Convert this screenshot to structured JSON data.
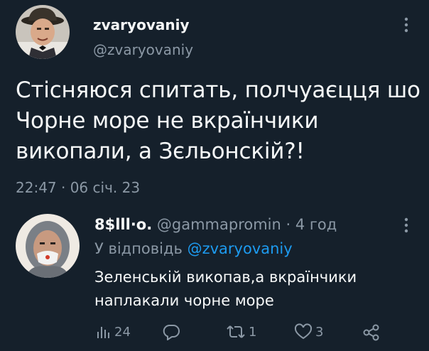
{
  "tweet": {
    "author_name": "zvaryovaniy",
    "author_handle": "@zvaryovaniy",
    "text": "Стісняюся спитать, полчуаєцця шо Чорне море не вкраїнчики викопали, а Зєльонскій?!",
    "timestamp": "22:47 · 06 січ. 23"
  },
  "reply": {
    "author_name": "8$lll·o.",
    "author_handle": "@gammapromin",
    "separator": " · ",
    "time": "4 год",
    "reply_to_prefix": "У відповідь ",
    "reply_to_handle": "@zvaryovaniy",
    "text": "Зеленській викопав,а вкраїнчики наплакали чорне море",
    "actions": {
      "views": "24",
      "replies": "",
      "retweets": "1",
      "likes": "3"
    }
  },
  "icons": [
    "more-icon",
    "views-icon",
    "reply-icon",
    "retweet-icon",
    "like-icon",
    "share-icon"
  ],
  "colors": {
    "background": "#15202b",
    "text": "#f7f9f9",
    "muted": "#8b98a5",
    "link": "#1d9bf0"
  }
}
